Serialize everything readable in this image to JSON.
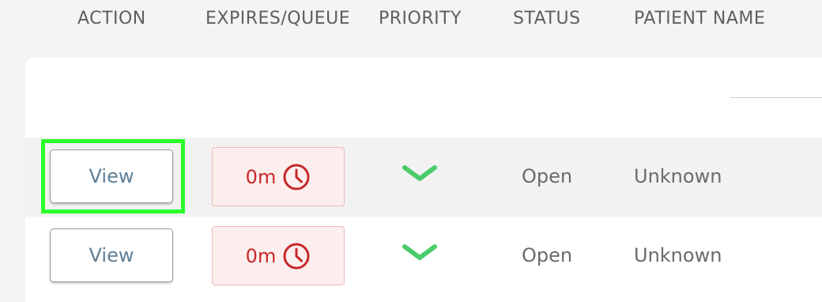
{
  "columns": {
    "action": "ACTION",
    "expires_queue": "EXPIRES/QUEUE",
    "priority": "PRIORITY",
    "status": "STATUS",
    "patient_name": "PATIENT NAME"
  },
  "rows": [
    {
      "action_label": "View",
      "expires": "0m",
      "expires_icon": "clock-icon",
      "priority_icon": "chevron-down-icon",
      "status": "Open",
      "patient_name": "Unknown",
      "focused": true
    },
    {
      "action_label": "View",
      "expires": "0m",
      "expires_icon": "clock-icon",
      "priority_icon": "chevron-down-icon",
      "status": "Open",
      "patient_name": "Unknown",
      "focused": false
    }
  ],
  "colors": {
    "focus_outline": "#2bff2b",
    "expires_text": "#c62828",
    "expires_bg": "#fdeeee",
    "priority_low": "#4ccb6a",
    "view_button_text": "#5e7e95"
  }
}
